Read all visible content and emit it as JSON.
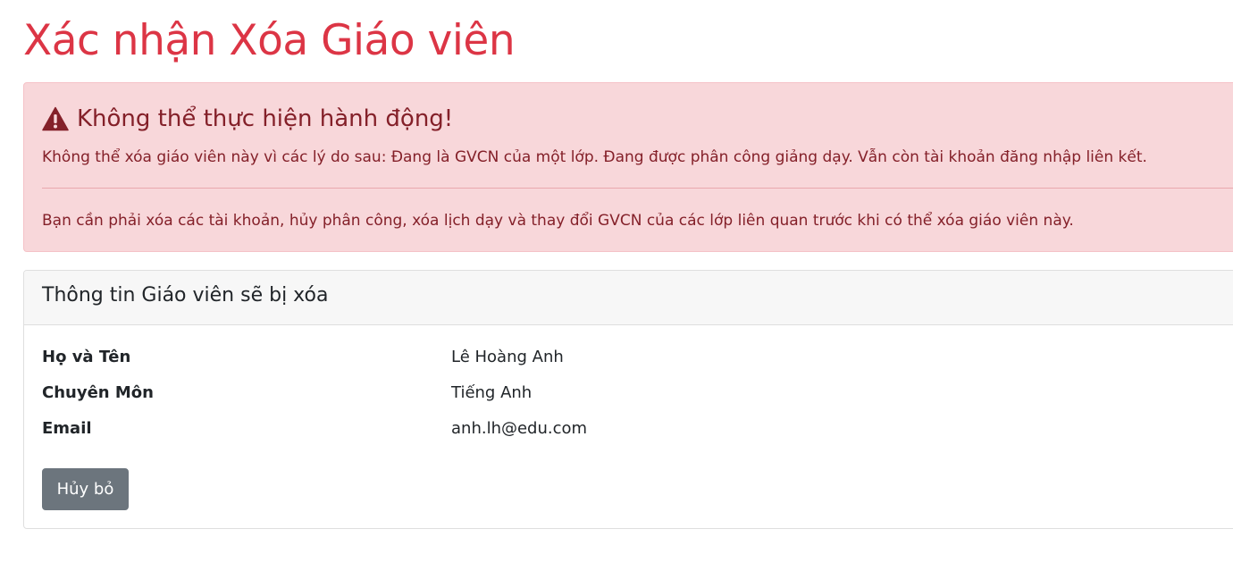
{
  "page": {
    "title": "Xác nhận Xóa Giáo viên"
  },
  "alert": {
    "icon": "warning-triangle-icon",
    "heading": "Không thể thực hiện hành động!",
    "reasons": "Không thể xóa giáo viên này vì các lý do sau: Đang là GVCN của một lớp. Đang được phân công giảng dạy. Vẫn còn tài khoản đăng nhập liên kết.",
    "instruction": "Bạn cần phải xóa các tài khoản, hủy phân công, xóa lịch dạy và thay đổi GVCN của các lớp liên quan trước khi có thể xóa giáo viên này.",
    "colors": {
      "background": "#f8d7da",
      "text": "#842029"
    }
  },
  "card": {
    "title": "Thông tin Giáo viên sẽ bị xóa",
    "fields": [
      {
        "label": "Họ và Tên",
        "value": "Lê Hoàng Anh"
      },
      {
        "label": "Chuyên Môn",
        "value": "Tiếng Anh"
      },
      {
        "label": "Email",
        "value": "anh.lh@edu.com"
      }
    ],
    "cancel_label": "Hủy bỏ"
  },
  "colors": {
    "title": "#dc3545",
    "secondary_button": "#6c757d"
  }
}
